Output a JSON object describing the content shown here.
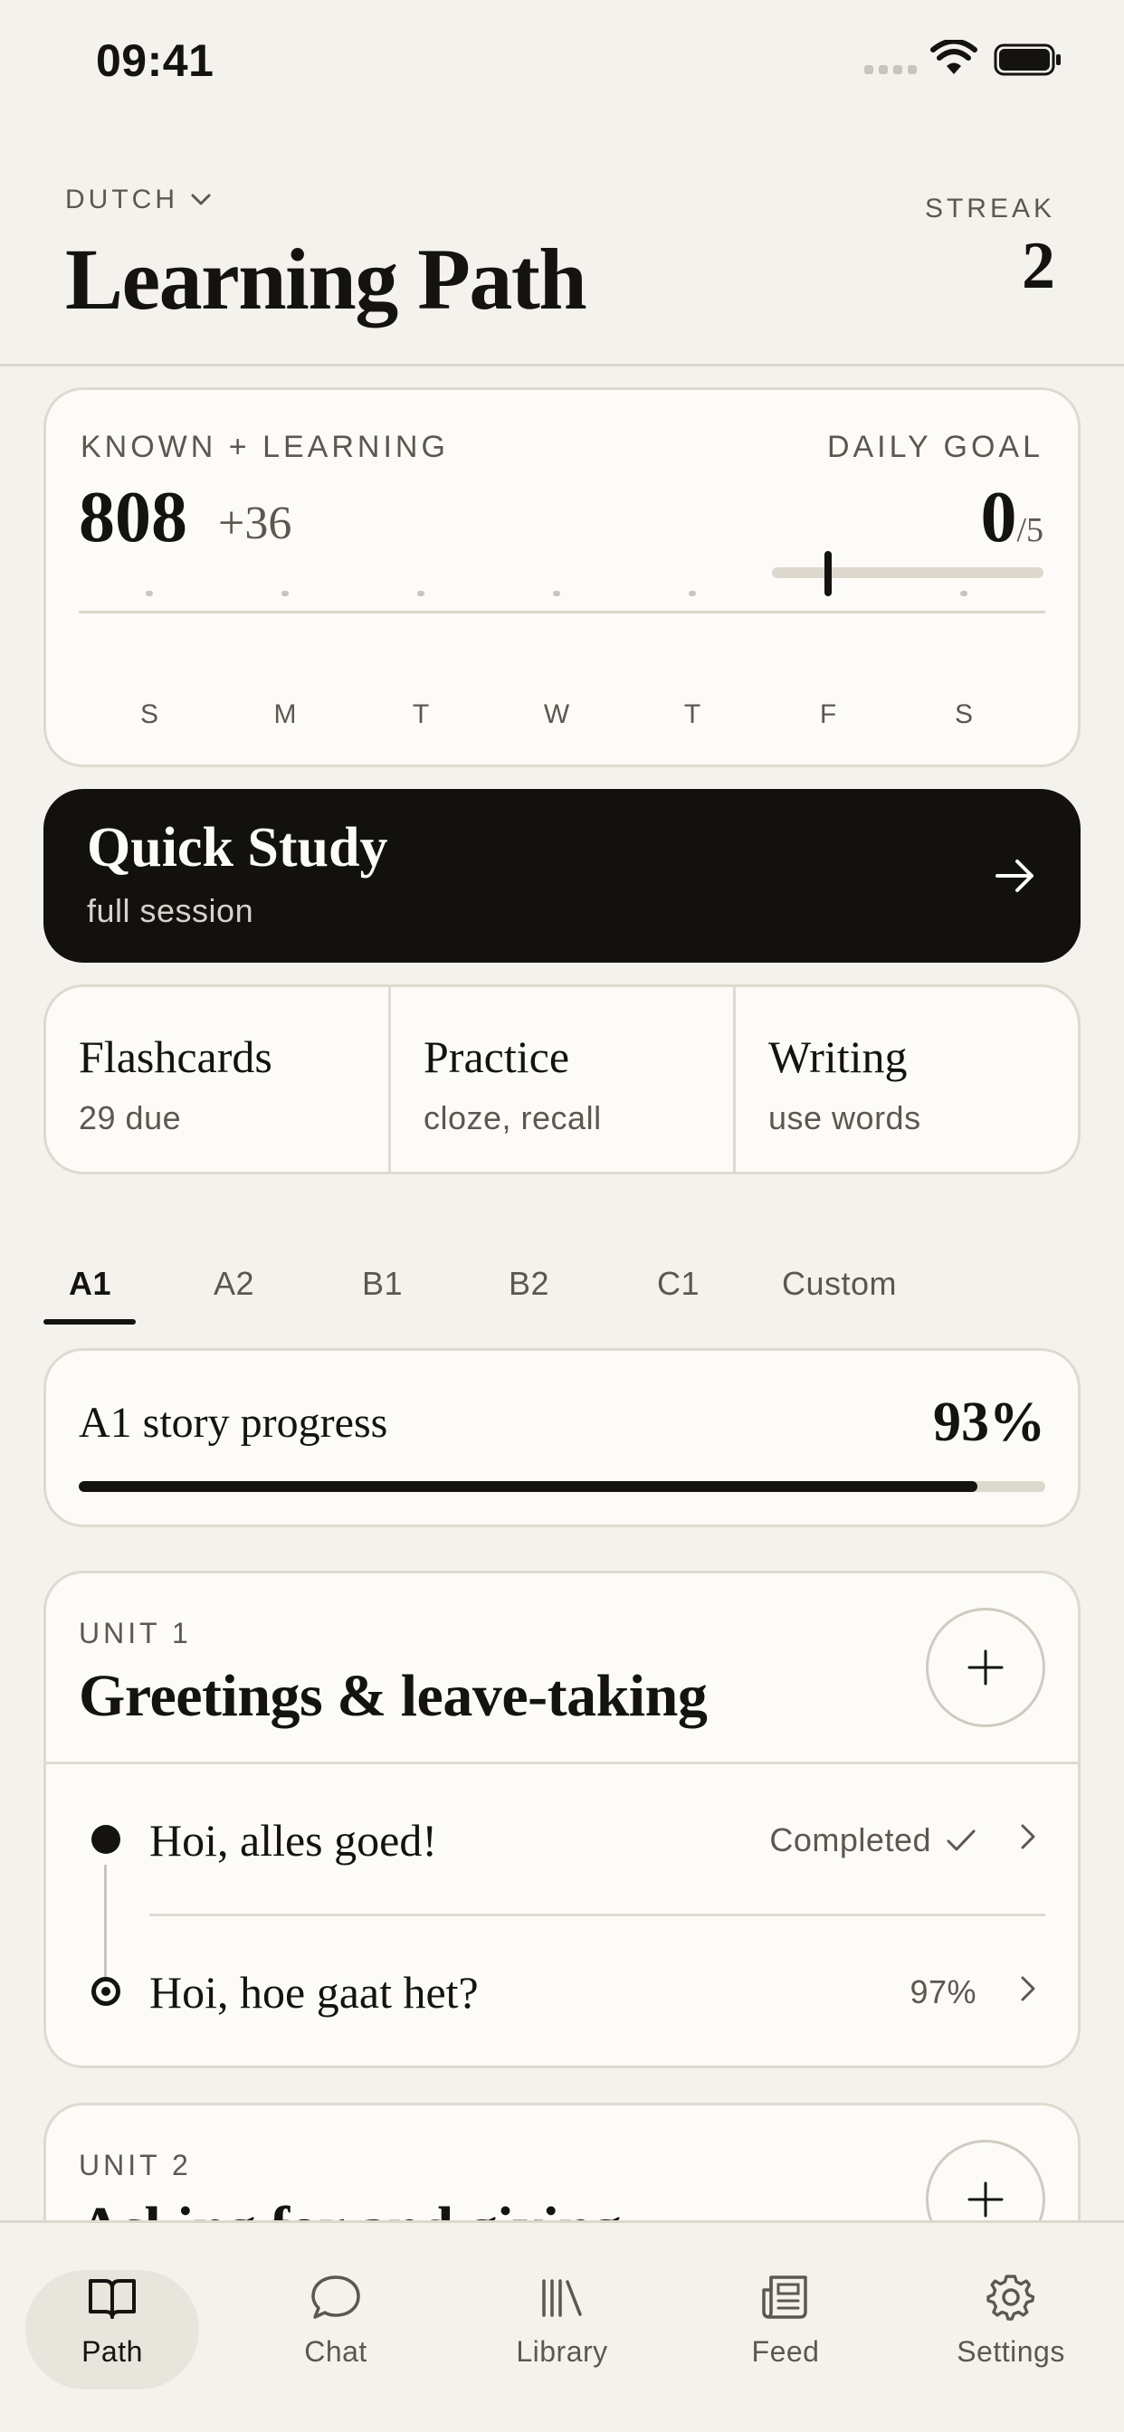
{
  "status_bar": {
    "time": "09:41"
  },
  "header": {
    "language": "DUTCH",
    "title": "Learning Path",
    "streak_label": "STREAK",
    "streak_value": "2"
  },
  "stats": {
    "known_label": "KNOWN + LEARNING",
    "known_value": "808",
    "known_delta": "+36",
    "goal_label": "DAILY GOAL",
    "goal_done": "0",
    "goal_total": "/5",
    "goal_progress": 0,
    "week": [
      {
        "label": "S",
        "active": false
      },
      {
        "label": "M",
        "active": false
      },
      {
        "label": "T",
        "active": false
      },
      {
        "label": "W",
        "active": false
      },
      {
        "label": "T",
        "active": false
      },
      {
        "label": "F",
        "active": true
      },
      {
        "label": "S",
        "active": false
      }
    ]
  },
  "quick_study": {
    "title": "Quick Study",
    "subtitle": "full session"
  },
  "modes": [
    {
      "title": "Flashcards",
      "subtitle": "29 due"
    },
    {
      "title": "Practice",
      "subtitle": "cloze, recall"
    },
    {
      "title": "Writing",
      "subtitle": "use words"
    }
  ],
  "levels": {
    "active": "A1",
    "tabs": [
      "A1",
      "A2",
      "B1",
      "B2",
      "C1",
      "Custom"
    ]
  },
  "story_progress": {
    "label": "A1 story progress",
    "percent_label": "93%",
    "value": 93
  },
  "units": [
    {
      "label": "UNIT 1",
      "title": "Greetings & leave-taking",
      "lessons": [
        {
          "title": "Hoi, alles goed!",
          "status": "Completed"
        },
        {
          "title": "Hoi, hoe gaat het?",
          "status": "97%"
        }
      ]
    },
    {
      "label": "UNIT 2",
      "title": "Asking for and giving"
    }
  ],
  "nav": {
    "active": "Path",
    "items": [
      "Path",
      "Chat",
      "Library",
      "Feed",
      "Settings"
    ]
  },
  "colors": {
    "background": "#f4f2ec",
    "card": "#fcfbf7",
    "ink": "#141310",
    "muted": "#5b5850",
    "rule": "#dcd8cd"
  }
}
